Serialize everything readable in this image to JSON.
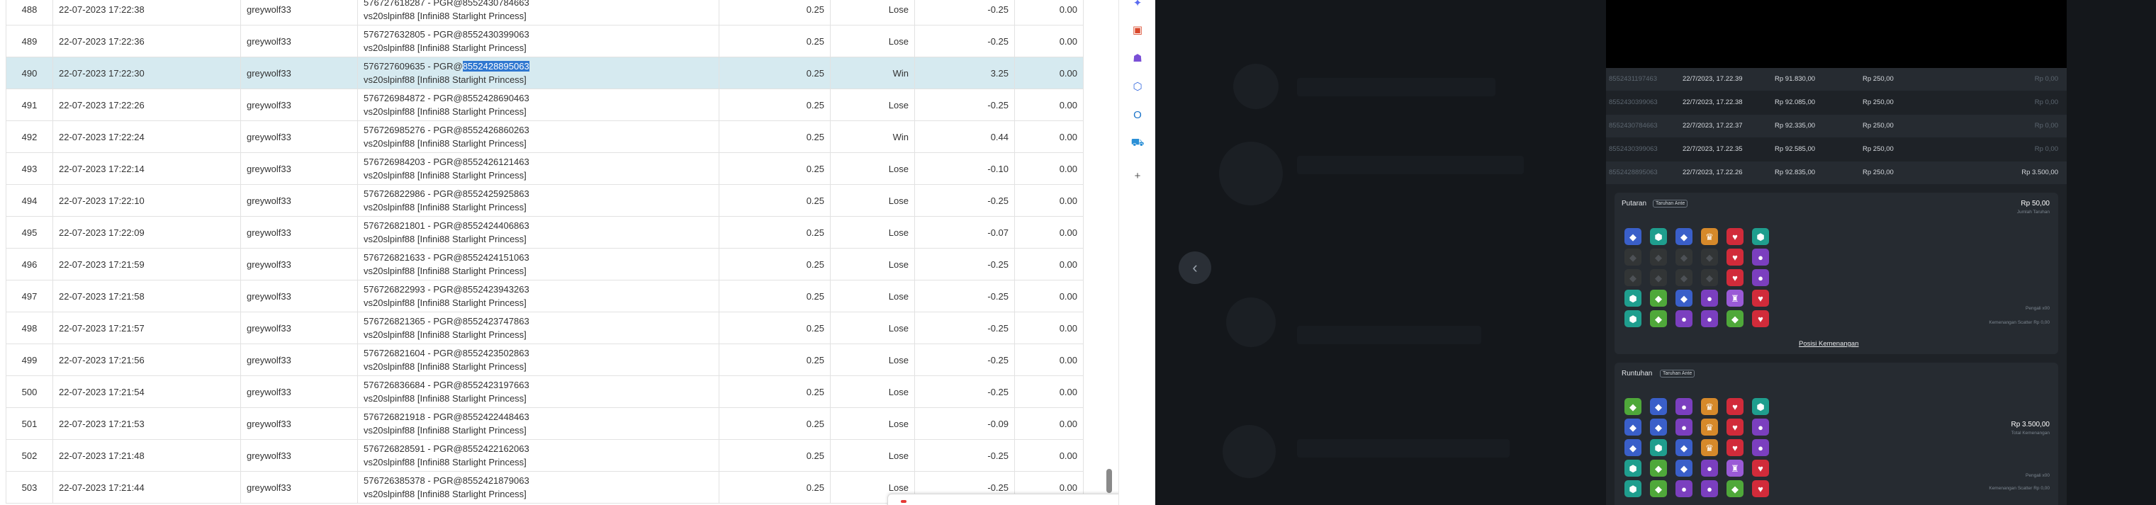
{
  "table": {
    "rows": [
      {
        "no": "488",
        "date": "22-07-2023 17:22:38",
        "user": "greywolf33",
        "ref": "576727618287 - PGR@8552430784663",
        "ref_sel": "",
        "game": "vs20slpinf88 [Infini88 Starlight Princess]",
        "bet": "0.25",
        "result": "Lose",
        "winlose": "-0.25",
        "jp": "0.00"
      },
      {
        "no": "489",
        "date": "22-07-2023 17:22:36",
        "user": "greywolf33",
        "ref": "576727632805 - PGR@8552430399063",
        "ref_sel": "",
        "game": "vs20slpinf88 [Infini88 Starlight Princess]",
        "bet": "0.25",
        "result": "Lose",
        "winlose": "-0.25",
        "jp": "0.00"
      },
      {
        "no": "490",
        "date": "22-07-2023 17:22:30",
        "user": "greywolf33",
        "ref": "576727609635 - PGR@",
        "ref_sel": "8552428895063",
        "game": "vs20slpinf88 [Infini88 Starlight Princess]",
        "bet": "0.25",
        "result": "Win",
        "winlose": "3.25",
        "jp": "0.00"
      },
      {
        "no": "491",
        "date": "22-07-2023 17:22:26",
        "user": "greywolf33",
        "ref": "576726984872 - PGR@8552428690463",
        "ref_sel": "",
        "game": "vs20slpinf88 [Infini88 Starlight Princess]",
        "bet": "0.25",
        "result": "Lose",
        "winlose": "-0.25",
        "jp": "0.00"
      },
      {
        "no": "492",
        "date": "22-07-2023 17:22:24",
        "user": "greywolf33",
        "ref": "576726985276 - PGR@8552426860263",
        "ref_sel": "",
        "game": "vs20slpinf88 [Infini88 Starlight Princess]",
        "bet": "0.25",
        "result": "Win",
        "winlose": "0.44",
        "jp": "0.00"
      },
      {
        "no": "493",
        "date": "22-07-2023 17:22:14",
        "user": "greywolf33",
        "ref": "576726984203 - PGR@8552426121463",
        "ref_sel": "",
        "game": "vs20slpinf88 [Infini88 Starlight Princess]",
        "bet": "0.25",
        "result": "Lose",
        "winlose": "-0.10",
        "jp": "0.00"
      },
      {
        "no": "494",
        "date": "22-07-2023 17:22:10",
        "user": "greywolf33",
        "ref": "576726822986 - PGR@8552425925863",
        "ref_sel": "",
        "game": "vs20slpinf88 [Infini88 Starlight Princess]",
        "bet": "0.25",
        "result": "Lose",
        "winlose": "-0.25",
        "jp": "0.00"
      },
      {
        "no": "495",
        "date": "22-07-2023 17:22:09",
        "user": "greywolf33",
        "ref": "576726821801 - PGR@8552424406863",
        "ref_sel": "",
        "game": "vs20slpinf88 [Infini88 Starlight Princess]",
        "bet": "0.25",
        "result": "Lose",
        "winlose": "-0.07",
        "jp": "0.00"
      },
      {
        "no": "496",
        "date": "22-07-2023 17:21:59",
        "user": "greywolf33",
        "ref": "576726821633 - PGR@8552424151063",
        "ref_sel": "",
        "game": "vs20slpinf88 [Infini88 Starlight Princess]",
        "bet": "0.25",
        "result": "Lose",
        "winlose": "-0.25",
        "jp": "0.00"
      },
      {
        "no": "497",
        "date": "22-07-2023 17:21:58",
        "user": "greywolf33",
        "ref": "576726822993 - PGR@8552423943263",
        "ref_sel": "",
        "game": "vs20slpinf88 [Infini88 Starlight Princess]",
        "bet": "0.25",
        "result": "Lose",
        "winlose": "-0.25",
        "jp": "0.00"
      },
      {
        "no": "498",
        "date": "22-07-2023 17:21:57",
        "user": "greywolf33",
        "ref": "576726821365 - PGR@8552423747863",
        "ref_sel": "",
        "game": "vs20slpinf88 [Infini88 Starlight Princess]",
        "bet": "0.25",
        "result": "Lose",
        "winlose": "-0.25",
        "jp": "0.00"
      },
      {
        "no": "499",
        "date": "22-07-2023 17:21:56",
        "user": "greywolf33",
        "ref": "576726821604 - PGR@8552423502863",
        "ref_sel": "",
        "game": "vs20slpinf88 [Infini88 Starlight Princess]",
        "bet": "0.25",
        "result": "Lose",
        "winlose": "-0.25",
        "jp": "0.00"
      },
      {
        "no": "500",
        "date": "22-07-2023 17:21:54",
        "user": "greywolf33",
        "ref": "576726836684 - PGR@8552423197663",
        "ref_sel": "",
        "game": "vs20slpinf88 [Infini88 Starlight Princess]",
        "bet": "0.25",
        "result": "Lose",
        "winlose": "-0.25",
        "jp": "0.00"
      },
      {
        "no": "501",
        "date": "22-07-2023 17:21:53",
        "user": "greywolf33",
        "ref": "576726821918 - PGR@8552422448463",
        "ref_sel": "",
        "game": "vs20slpinf88 [Infini88 Starlight Princess]",
        "bet": "0.25",
        "result": "Lose",
        "winlose": "-0.09",
        "jp": "0.00"
      },
      {
        "no": "502",
        "date": "22-07-2023 17:21:48",
        "user": "greywolf33",
        "ref": "576726828591 - PGR@8552422162063",
        "ref_sel": "",
        "game": "vs20slpinf88 [Infini88 Starlight Princess]",
        "bet": "0.25",
        "result": "Lose",
        "winlose": "-0.25",
        "jp": "0.00"
      },
      {
        "no": "503",
        "date": "22-07-2023 17:21:44",
        "user": "greywolf33",
        "ref": "576726385378 - PGR@8552421879063",
        "ref_sel": "",
        "game": "vs20slpinf88 [Infini88 Starlight Princess]",
        "bet": "0.25",
        "result": "Lose",
        "winlose": "-0.25",
        "jp": "0.00"
      }
    ]
  },
  "side_icons": [
    {
      "name": "shopping-bag-icon",
      "glyph": "✦",
      "color": "#5b6cf0"
    },
    {
      "name": "toolbox-icon",
      "glyph": "▣",
      "color": "#d9482b"
    },
    {
      "name": "people-icon",
      "glyph": "☗",
      "color": "#7a4fd6"
    },
    {
      "name": "copilot-icon",
      "glyph": "⬡",
      "color": "#3d6fe0"
    },
    {
      "name": "outlook-icon",
      "glyph": "O",
      "color": "#1a73c9"
    },
    {
      "name": "shopping-cart-icon",
      "glyph": "⛟",
      "color": "#2a8fd6"
    },
    {
      "name": "add-icon",
      "glyph": "+",
      "color": "#555555"
    }
  ],
  "history": [
    {
      "id": "8552431197463",
      "date": "22/7/2023, 17.22.39",
      "balance": "Rp 91.830,00",
      "bet": "Rp 250,00",
      "win": "Rp 0,00"
    },
    {
      "id": "8552430399063",
      "date": "22/7/2023, 17.22.38",
      "balance": "Rp 92.085,00",
      "bet": "Rp 250,00",
      "win": "Rp 0,00"
    },
    {
      "id": "8552430784663",
      "date": "22/7/2023, 17.22.37",
      "balance": "Rp 92.335,00",
      "bet": "Rp 250,00",
      "win": "Rp 0,00"
    },
    {
      "id": "8552430399063",
      "date": "22/7/2023, 17.22.35",
      "balance": "Rp 92.585,00",
      "bet": "Rp 250,00",
      "win": "Rp 0,00"
    },
    {
      "id": "8552428895063",
      "date": "22/7/2023, 17.22.26",
      "balance": "Rp 92.835,00",
      "bet": "Rp 250,00",
      "win": "Rp 3.500,00"
    }
  ],
  "putaran": {
    "title": "Putaran",
    "badge": "Taruhan Ante",
    "amount": "Rp 50,00",
    "sub": "Jumlah Taruhan",
    "note1": "Pengali x00",
    "note2": "Kemenangan Scatter Rp 0,00",
    "link": "Posisi Kemenangan",
    "grid": [
      [
        "blue",
        "teal",
        "blue",
        "crown",
        "heart",
        "teal"
      ],
      [
        "dim",
        "dim",
        "dim",
        "dim",
        "heart",
        "purple"
      ],
      [
        "dim",
        "dim",
        "dim",
        "dim",
        "heart",
        "purple"
      ],
      [
        "teal",
        "green",
        "blue",
        "purple",
        "chalice",
        "heart"
      ],
      [
        "teal",
        "green",
        "purple",
        "purple",
        "green",
        "heart"
      ]
    ]
  },
  "runtuhan": {
    "title": "Runtuhan",
    "badge": "Taruhan Ante",
    "amount": "Rp 3.500,00",
    "sub": "Total Kemenangan",
    "note1": "Pengali x00",
    "note2": "Kemenangan Scatter Rp 0,00",
    "grid": [
      [
        "green",
        "blue",
        "purple",
        "crown",
        "heart",
        "teal"
      ],
      [
        "blue",
        "blue",
        "purple",
        "crown",
        "heart",
        "purple"
      ],
      [
        "blue",
        "teal",
        "blue",
        "crown",
        "heart",
        "purple"
      ],
      [
        "teal",
        "green",
        "blue",
        "purple",
        "chalice",
        "heart"
      ],
      [
        "teal",
        "green",
        "purple",
        "purple",
        "green",
        "heart"
      ]
    ]
  },
  "gem_colors": {
    "blue": "#3a5fc9",
    "teal": "#1f9e8e",
    "green": "#4fa83a",
    "purple": "#7b3fbf",
    "heart": "#d12b3a",
    "crown": "#d6892a",
    "chalice": "#9a5ad6",
    "dim": "#6b6450"
  },
  "gem_glyphs": {
    "blue": "◆",
    "teal": "⬢",
    "green": "◆",
    "purple": "●",
    "heart": "♥",
    "crown": "♛",
    "chalice": "♜",
    "dim": "◆"
  }
}
